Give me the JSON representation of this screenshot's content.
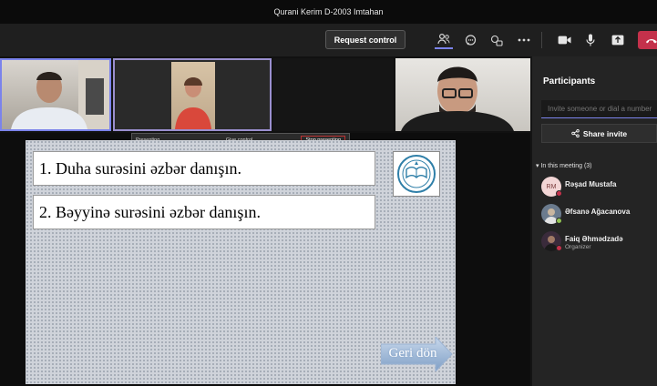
{
  "window": {
    "title": "Qurani Kerim D-2003 Imtahan"
  },
  "toolbar": {
    "request_control": "Request control",
    "icons": [
      "people-icon",
      "chat-icon",
      "reactions-icon",
      "more-icon",
      "camera-icon",
      "mic-icon",
      "share-icon",
      "hangup-icon"
    ]
  },
  "presenter_bar": {
    "presenting": "Presenting...",
    "give_control": "Give control",
    "stop_presenting": "Stop presenting"
  },
  "slide": {
    "question_1": "1. Duha surəsini əzbər danışın.",
    "question_2": "2. Bəyyinə surəsini əzbər danışın.",
    "back_button": "Geri dön"
  },
  "participants_panel": {
    "title": "Participants",
    "invite_placeholder": "Invite someone or dial a number",
    "share_invite": "Share invite",
    "in_meeting": "In this meeting (3)",
    "participants": [
      {
        "name": "Rəşad Mustafa",
        "initials": "RM",
        "role": "",
        "avatar_bg": "#f3d6d6",
        "presence": "#c4314b"
      },
      {
        "name": "Əfsanə Ağacanova",
        "initials": "",
        "role": "",
        "avatar_bg": "#6b7b8e",
        "presence": "#92c353"
      },
      {
        "name": "Faiq Əhmədzadə",
        "initials": "",
        "role": "Organizer",
        "avatar_bg": "#3a2b3b",
        "presence": "#c4314b"
      }
    ]
  },
  "colors": {
    "accent": "#7b83eb",
    "leave": "#c4314b"
  }
}
